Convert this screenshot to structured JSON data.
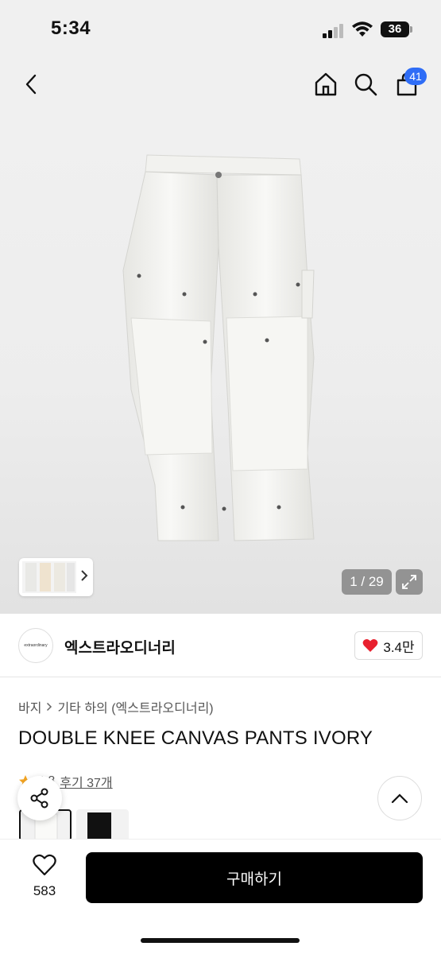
{
  "status_bar": {
    "time": "5:34",
    "battery": "36"
  },
  "nav": {
    "cart_count": "41",
    "icons": [
      "back-icon",
      "home-icon",
      "search-icon",
      "cart-icon"
    ]
  },
  "gallery": {
    "counter": "1 / 29"
  },
  "brand": {
    "logo_text": "extraordinary",
    "name": "엑스트라오디너리",
    "likes": "3.4만",
    "like_color": "#e8202e"
  },
  "breadcrumb": {
    "category": "바지",
    "subcategory": "기타 하의 (엑스트라오디너리)"
  },
  "product": {
    "title": "DOUBLE KNEE CANVAS PANTS IVORY"
  },
  "rating": {
    "score": "4.8",
    "reviews": "후기 37개",
    "star_color": "#f5a623"
  },
  "bottom": {
    "wish_count": "583",
    "buy_label": "구매하기"
  }
}
